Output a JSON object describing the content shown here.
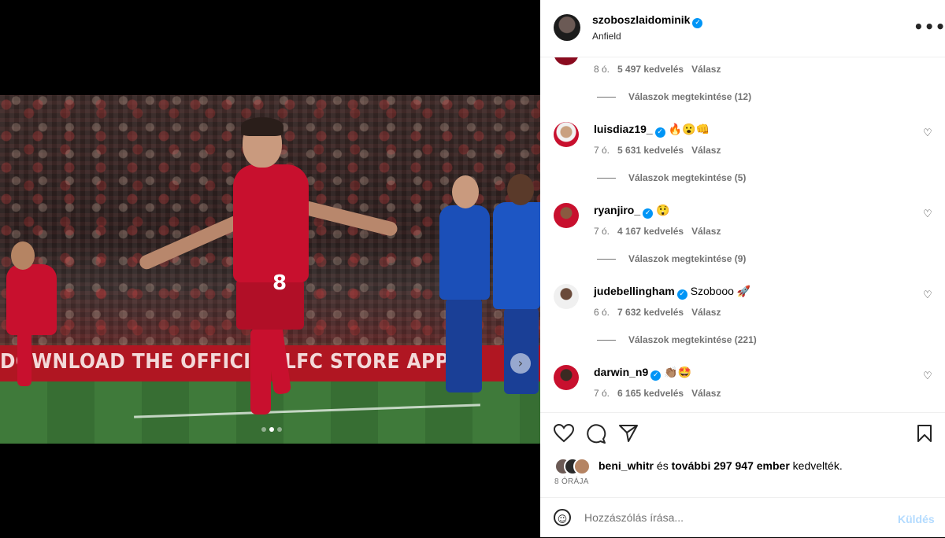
{
  "header": {
    "username": "szoboszlaidominik",
    "location": "Anfield",
    "more_glyph": "•••"
  },
  "media": {
    "board_text": "DOWNLOAD THE OFFICIAL LFC STORE APP!",
    "jersey_number": "8",
    "next_glyph": "›"
  },
  "comments": {
    "first_partial": {
      "time": "8 ó.",
      "likes": "5 497 kedvelés",
      "reply": "Válasz"
    },
    "first_view": "Válaszok megtekintése (12)",
    "items": [
      {
        "user": "luisdiaz19_",
        "text": "🔥😮👊",
        "time": "7 ó.",
        "likes": "5 631 kedvelés",
        "reply": "Válasz",
        "view": "Válaszok megtekintése (5)"
      },
      {
        "user": "ryanjiro_",
        "text": "😲",
        "time": "7 ó.",
        "likes": "4 167 kedvelés",
        "reply": "Válasz",
        "view": "Válaszok megtekintése (9)"
      },
      {
        "user": "judebellingham",
        "text": "Szobooo 🚀",
        "time": "6 ó.",
        "likes": "7 632 kedvelés",
        "reply": "Válasz",
        "view": "Válaszok megtekintése (221)"
      },
      {
        "user": "darwin_n9",
        "text": "👏🏽🤩",
        "time": "7 ó.",
        "likes": "6 165 kedvelés",
        "reply": "Válasz",
        "view": ""
      }
    ]
  },
  "likes_summary": {
    "user": "beni_whitr",
    "connector": "és",
    "others": "további 297 947 ember",
    "suffix": "kedvelték."
  },
  "timestamp": "8 ÓRÁJA",
  "composer": {
    "placeholder": "Hozzászólás írása...",
    "post_label": "Küldés"
  },
  "icons": {
    "heart": "heart-icon",
    "comment": "comment-icon",
    "share": "share-icon",
    "save": "bookmark-icon",
    "emoji": "emoji-icon",
    "verified": "verified-badge-icon"
  },
  "colors": {
    "verified": "#0095f6",
    "post_disabled": "#b3dbff",
    "muted": "#737373"
  }
}
